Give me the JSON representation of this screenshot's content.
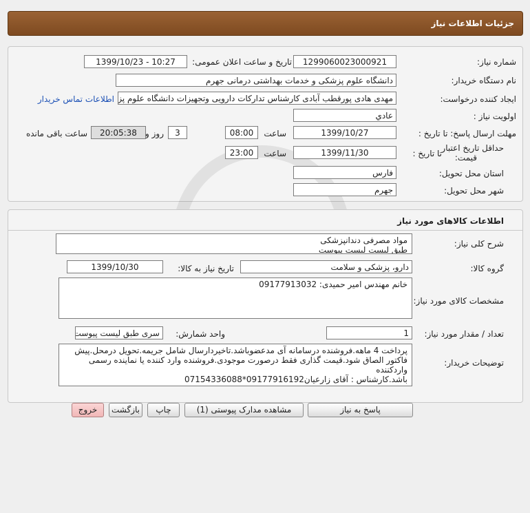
{
  "window": {
    "title": "جزئیات اطلاعات نیاز"
  },
  "general": {
    "need_number_label": "شماره نیاز:",
    "need_number": "1299060023000921",
    "announce_label": "تاریخ و ساعت اعلان عمومی:",
    "announce_value": "1399/10/23 - 10:27",
    "buyer_org_label": "نام دستگاه خریدار:",
    "buyer_org": "دانشگاه علوم پزشکی و خدمات بهداشتی درمانی جهرم",
    "requester_label": "ایجاد کننده درخواست:",
    "requester": "مهدی هادی پورقطب آبادی کارشناس تدارکات دارویی وتجهیزات دانشگاه علوم پزشکی",
    "contact_link": "اطلاعات تماس خریدار",
    "priority_label": "اولویت نیاز :",
    "priority": "عادي",
    "deadline_label": "مهلت ارسال پاسخ:  تا تاریخ :",
    "deadline_date": "1399/10/27",
    "time_label": "ساعت",
    "deadline_time": "08:00",
    "days_value": "3",
    "days_label": "روز و",
    "remaining_time": "20:05:38",
    "remaining_label": "ساعت باقی مانده",
    "validity_label_1": "حداقل تاریخ اعتبار",
    "validity_label_2": "قیمت:",
    "validity_until_label": "تا تاریخ :",
    "validity_date": "1399/11/30",
    "validity_time_label": "ساعت",
    "validity_time": "23:00",
    "province_label": "استان محل تحویل:",
    "province": "فارس",
    "city_label": "شهر محل تحویل:",
    "city": "جهرم"
  },
  "goods": {
    "section_title": "اطلاعات کالاهای مورد نیاز",
    "description_label": "شرح کلی نیاز:",
    "description_line1": "مواد مصرفی دندانپزشکی",
    "description_line2": "طبق لیست لیست پیوست",
    "group_label": "گروه کالا:",
    "group": "دارو، پزشکی و سلامت",
    "need_date_label": "تاریخ نیاز به کالا:",
    "need_date": "1399/10/30",
    "specs_label": "مشخصات کالای مورد نیاز:",
    "specs": "خانم مهندس امیر حمیدی: 09177913032",
    "qty_label": "تعداد / مقدار مورد نیاز:",
    "qty": "1",
    "unit_label": "واحد شمارش:",
    "unit": "سری طبق لیست پیوست",
    "notes_label": "توضیحات خریدار:",
    "notes_line1": "پرداخت 4 ماهه.فروشنده درسامانه آی مدعضوباشد.تاخیردارسال شامل جریمه.تحویل درمحل.پیش",
    "notes_line2": "فاکتور الصاق شود.قیمت گذاری فقط درصورت موجودی.فروشنده وارد کننده یا نماینده رسمی واردکننده",
    "notes_line3": "باشد.کارشناس : آقای زارعیان09177916192*07154336088"
  },
  "buttons": {
    "reply": "پاسخ به نیاز",
    "attachments": "مشاهده مدارک پیوستی (1)",
    "print": "چاپ",
    "back": "بازگشت",
    "exit": "خروج"
  },
  "colors": {
    "title_bar": "#8b5528",
    "exit_button": "#f1b7b7"
  }
}
